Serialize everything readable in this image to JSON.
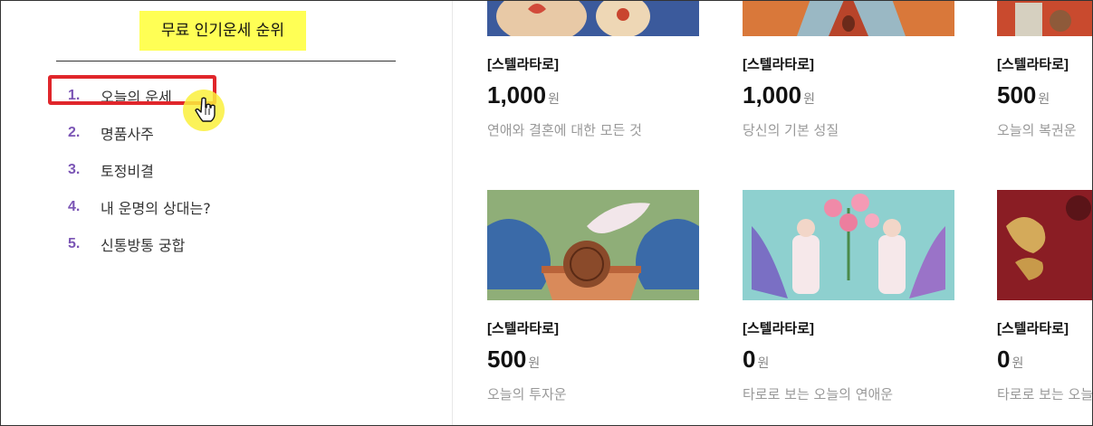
{
  "ranking": {
    "title": "무료 인기운세 순위",
    "items": [
      {
        "num": "1.",
        "label": "오늘의 운세"
      },
      {
        "num": "2.",
        "label": "명품사주"
      },
      {
        "num": "3.",
        "label": "토정비결"
      },
      {
        "num": "4.",
        "label": "내 운명의 상대는?"
      },
      {
        "num": "5.",
        "label": "신통방통 궁합"
      }
    ]
  },
  "products": [
    {
      "brand": "[스텔라타로]",
      "price": "1,000",
      "unit": "원",
      "desc": "연애와 결혼에 대한 모든 것"
    },
    {
      "brand": "[스텔라타로]",
      "price": "1,000",
      "unit": "원",
      "desc": "당신의 기본 성질"
    },
    {
      "brand": "[스텔라타로]",
      "price": "500",
      "unit": "원",
      "desc": "오늘의 복권운"
    },
    {
      "brand": "[스텔라타로]",
      "price": "500",
      "unit": "원",
      "desc": "오늘의 투자운"
    },
    {
      "brand": "[스텔라타로]",
      "price": "0",
      "unit": "원",
      "desc": "타로로 보는 오늘의 연애운"
    },
    {
      "brand": "[스텔라타로]",
      "price": "0",
      "unit": "원",
      "desc": "타로로 보는 오늘의 연애운"
    }
  ],
  "colors": {
    "highlight": "#e0262b",
    "title_bg": "#ffff55",
    "rank_num": "#7b55b5"
  }
}
